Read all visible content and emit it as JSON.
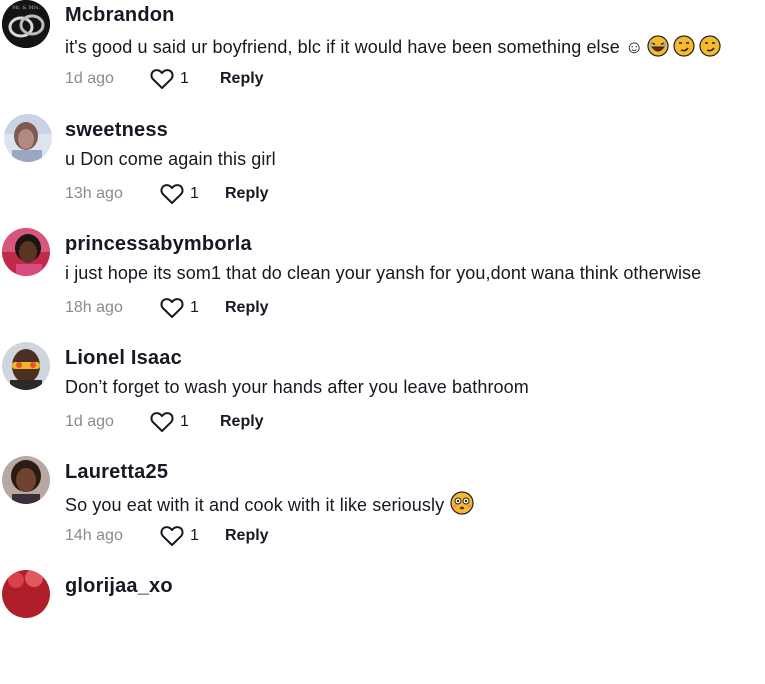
{
  "comments": [
    {
      "username": "Mcbrandon",
      "text": "it's good u said ur boyfriend, blc if it would have been something else ☺",
      "time": "1d ago",
      "likes": "1",
      "reply": "Reply",
      "avatar": "rings-avatar",
      "avatar_caption": "Mr. & Mrs.",
      "emojis": [
        "laughing-face-icon",
        "smirk-face-icon",
        "smirk-face-icon"
      ]
    },
    {
      "username": "sweetness",
      "text": "u Don come again this girl",
      "time": "13h ago",
      "likes": "1",
      "reply": "Reply",
      "avatar": "user-photo-avatar",
      "emojis": []
    },
    {
      "username": "princessabymborla",
      "text": "i just hope its som1 that do clean your yansh for you,dont wana think otherwise",
      "time": "18h ago",
      "likes": "1",
      "reply": "Reply",
      "avatar": "user-photo-avatar",
      "emojis": []
    },
    {
      "username": "Lionel Isaac",
      "text": "Don’t forget to wash your hands after you leave bathroom",
      "time": "1d ago",
      "likes": "1",
      "reply": "Reply",
      "avatar": "user-photo-avatar",
      "emojis": []
    },
    {
      "username": "Lauretta25",
      "text": "So you eat with it and cook with it like seriously",
      "time": "14h ago",
      "likes": "1",
      "reply": "Reply",
      "avatar": "user-photo-avatar",
      "emojis": [
        "flushed-face-icon"
      ]
    },
    {
      "username": "glorijaa_xo",
      "text": "",
      "time": "",
      "likes": "",
      "reply": "",
      "avatar": "user-photo-avatar",
      "emojis": []
    }
  ],
  "colors": {
    "text": "#161823",
    "secondary": "#8a8b91",
    "background": "#ffffff"
  },
  "icons": {
    "like": "heart-outline-icon"
  }
}
